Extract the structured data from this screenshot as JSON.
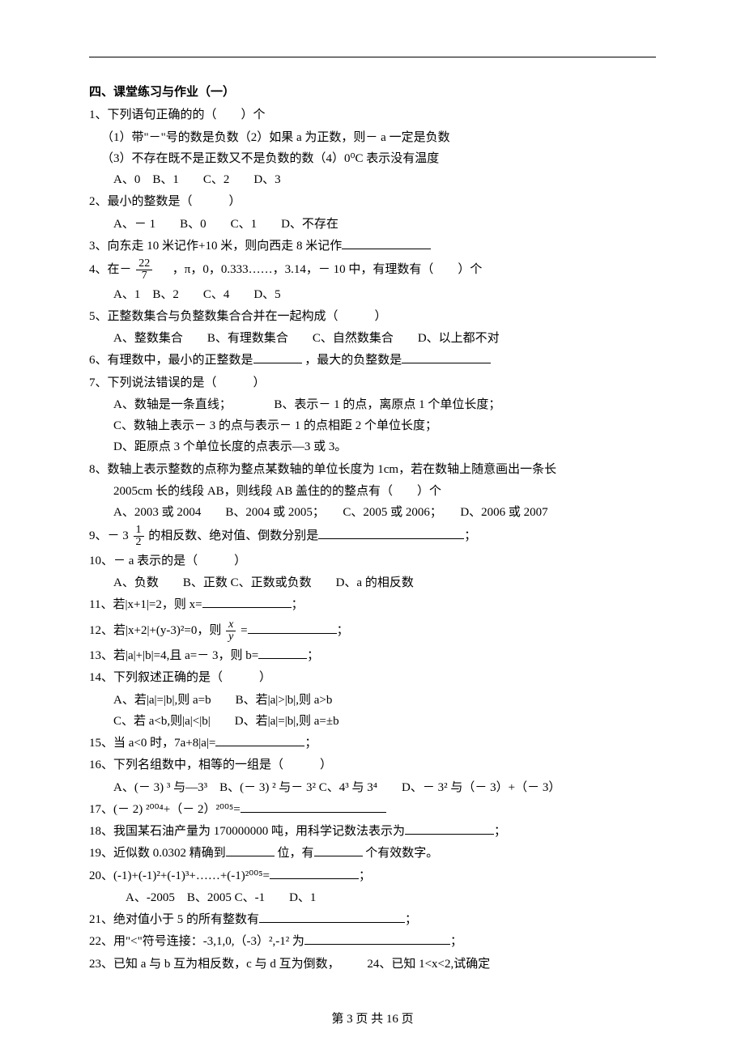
{
  "section_title": "四、课堂练习与作业（一）",
  "q1": {
    "stem": "1、下列语句正确的的（　　）个",
    "s1": "（1）带\"－\"号的数是负数（2）如果 a 为正数，则－ a 一定是负数",
    "s2": "（3）不存在既不是正数又不是负数的数（4）0⁰C 表示没有温度",
    "opts": "A、0　B、1　　C、2　　D、3"
  },
  "q2": {
    "stem": "2、最小的整数是（　　　）",
    "opts": "A、－ 1　　B、0　　C、1　　D、不存在"
  },
  "q3": "3、向东走 10 米记作+10 米，则向西走 8 米记作",
  "q4": {
    "pre": "4、在－",
    "post": "，π，0，0.333……，3.14，－ 10 中，有理数有（　　）个",
    "opts": "A、1　B、2　　C、4　　D、5",
    "num": "22",
    "den": "7"
  },
  "q5": {
    "stem": "5、正整数集合与负整数集合合并在一起构成（　　　）",
    "opts": "A、整数集合　　B、有理数集合　　C、自然数集合　　D、以上都不对"
  },
  "q6": {
    "a": "6、有理数中，最小的正整数是",
    "b": "，最大的负整数是"
  },
  "q7": {
    "stem": "7、下列说法错误的是（　　　）",
    "a": "A、数轴是一条直线；　　　　B、表示－ 1 的点，离原点 1 个单位长度；",
    "c": "C、数轴上表示－ 3 的点与表示－ 1 的点相距 2 个单位长度；",
    "d": "D、距原点 3 个单位长度的点表示—3 或 3。"
  },
  "q8": {
    "l1": "8、数轴上表示整数的点称为整点某数轴的单位长度为 1cm，若在数轴上随意画出一条长",
    "l2": "2005cm 长的线段 AB，则线段 AB 盖住的的整点有（　　）个",
    "opts": "A、2003 或 2004　　B、2004 或 2005；　　C、2005 或 2006；　　D、2006 或 2007"
  },
  "q9": {
    "pre": "9、－ 3",
    "num": "1",
    "den": "2",
    "post": "的相反数、绝对值、倒数分别是",
    "tail": "；"
  },
  "q10": {
    "stem": "10、－ a 表示的是（　　　）",
    "opts": "A、负数　　B、正数  C、正数或负数　　D、a 的相反数"
  },
  "q11": {
    "a": "11、若|x+1|=2，则 x=",
    "b": "；"
  },
  "q12": {
    "pre": "12、若|x+2|+(y-3)²=0，则",
    "num": "x",
    "den": "y",
    "mid": "=",
    "tail": "；"
  },
  "q13": {
    "a": "13、若|a|+|b|=4,且 a=－ 3，则 b=",
    "b": "；"
  },
  "q14": {
    "stem": "14、下列叙述正确的是（　　　）",
    "ab": "A、若|a|=|b|,则 a=b　　B、若|a|>|b|,则 a>b",
    "cd": "C、若 a<b,则|a|<|b|　　D、若|a|=|b|,则 a=±b"
  },
  "q15": {
    "a": "15、当 a<0 时，7a+8|a|=",
    "b": "；"
  },
  "q16": {
    "stem": "16、下列名组数中，相等的一组是（　　　）",
    "opts": "A、(－ 3) ³ 与—3³　B、(－ 3) ² 与－ 3² C、4³ 与 3⁴　　D、－ 3² 与（－ 3）+（－ 3）"
  },
  "q17": "17、(－ 2) ²⁰⁰⁴+（－ 2）²⁰⁰⁵=",
  "q18": {
    "a": "18、我国某石油产量为 170000000 吨，用科学记数法表示为",
    "b": "；"
  },
  "q19": {
    "a": "19、近似数 0.0302 精确到",
    "b": " 位，有",
    "c": "个有效数字。"
  },
  "q20": {
    "a": "20、(-1)+(-1)²+(-1)³+……+(-1)²⁰⁰⁵=",
    "b": "；",
    "opts": "A、-2005　B、2005  C、-1　　D、1"
  },
  "q21": {
    "a": "21、绝对值小于 5 的所有整数有",
    "b": "；"
  },
  "q22": {
    "a": "22、用\"<\"符号连接：-3,1,0,（-3）²,-1² 为",
    "b": "；"
  },
  "q23": "23、已知 a 与 b 互为相反数，c 与 d 互为倒数，",
  "q24": "24、已知 1<x<2,试确定",
  "footer": "第 3 页 共 16 页"
}
